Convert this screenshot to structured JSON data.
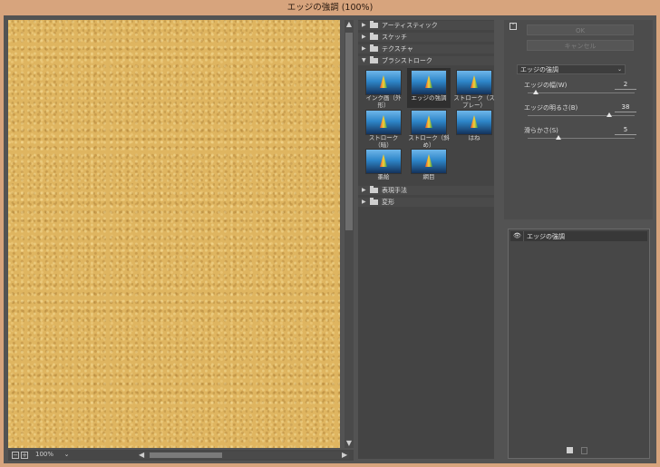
{
  "window": {
    "title": "エッジの強調 (100%)"
  },
  "preview": {
    "zoom": "100%",
    "zoom_minus": "−",
    "zoom_plus": "+"
  },
  "gallery": {
    "categories": [
      {
        "label": "アーティスティック",
        "expanded": false
      },
      {
        "label": "スケッチ",
        "expanded": false
      },
      {
        "label": "テクスチャ",
        "expanded": false
      },
      {
        "label": "ブラシストローク",
        "expanded": true
      },
      {
        "label": "表現手法",
        "expanded": false
      },
      {
        "label": "変形",
        "expanded": false
      }
    ],
    "brush_filters": [
      "インク画（外形）",
      "エッジの強調",
      "ストローク（スプレー）",
      "ストローク（暗）",
      "ストローク（斜め）",
      "はね",
      "墨絵",
      "網目"
    ],
    "selected_filter": "エッジの強調"
  },
  "controls": {
    "ok_label": "OK",
    "cancel_label": "キャンセル",
    "filter_select": "エッジの強調",
    "params": [
      {
        "label": "エッジの幅(W)",
        "value": "2",
        "min": 1,
        "max": 14
      },
      {
        "label": "エッジの明るさ(B)",
        "value": "38",
        "min": 0,
        "max": 50
      },
      {
        "label": "滑らかさ(S)",
        "value": "5",
        "min": 1,
        "max": 15
      }
    ]
  },
  "layers": {
    "items": [
      {
        "label": "エッジの強調",
        "visible": true
      }
    ]
  }
}
